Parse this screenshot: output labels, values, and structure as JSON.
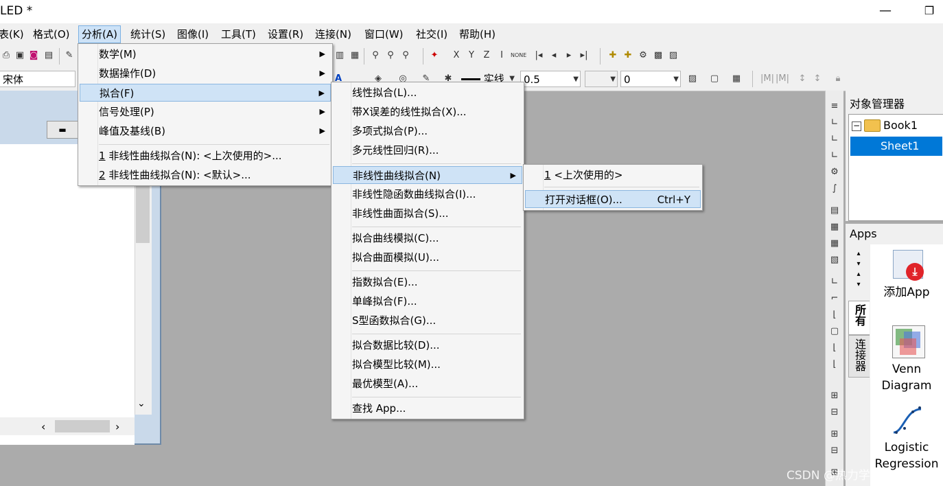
{
  "window": {
    "title": "LED *"
  },
  "menubar": {
    "items": [
      "表(K)",
      "格式(O)",
      "分析(A)",
      "统计(S)",
      "图像(I)",
      "工具(T)",
      "设置(R)",
      "连接(N)",
      "窗口(W)",
      "社交(I)",
      "帮助(H)"
    ],
    "active": "分析(A)"
  },
  "toolbar2": {
    "font": "宋体",
    "line_style": "实线",
    "line_width": "0.5",
    "value2": "0"
  },
  "analysis_menu": {
    "items": [
      "数学(M)",
      "数据操作(D)",
      "拟合(F)",
      "信号处理(P)",
      "峰值及基线(B)"
    ],
    "recent": [
      {
        "num": "1",
        "label": " 非线性曲线拟合(N): <上次使用的>..."
      },
      {
        "num": "2",
        "label": " 非线性曲线拟合(N): <默认>..."
      }
    ]
  },
  "fit_menu": {
    "group1": [
      "线性拟合(L)...",
      "带X误差的线性拟合(X)...",
      "多项式拟合(P)...",
      "多元线性回归(R)..."
    ],
    "group2": [
      "非线性曲线拟合(N)",
      "非线性隐函数曲线拟合(I)...",
      "非线性曲面拟合(S)..."
    ],
    "group3": [
      "拟合曲线模拟(C)...",
      "拟合曲面模拟(U)..."
    ],
    "group4": [
      "指数拟合(E)...",
      "单峰拟合(F)...",
      "S型函数拟合(G)..."
    ],
    "group5": [
      "拟合数据比较(D)...",
      "拟合模型比较(M)...",
      "最优模型(A)..."
    ],
    "group6": [
      "查找 App..."
    ]
  },
  "nonlinear_submenu": {
    "recent_num": "1",
    "recent_label": " <上次使用的>",
    "open_label": "打开对话框(O)...",
    "open_shortcut": "Ctrl+Y"
  },
  "object_manager": {
    "title": "对象管理器",
    "book": "Book1",
    "sheet": "Sheet1"
  },
  "apps": {
    "title": "Apps",
    "tabs": [
      "所有",
      "连接器"
    ],
    "items": [
      {
        "label": "添加App",
        "icon": "add-app-icon"
      },
      {
        "label": "Venn Diagram",
        "icon": "venn-diagram-icon"
      },
      {
        "label": "Logistic Regression",
        "icon": "logistic-regression-icon"
      }
    ]
  },
  "watermark": "CSDN @热力学费一定理",
  "colors": {
    "menu_highlight": "#cfe3f6",
    "selection": "#0078d7",
    "workspace": "#ababab"
  }
}
